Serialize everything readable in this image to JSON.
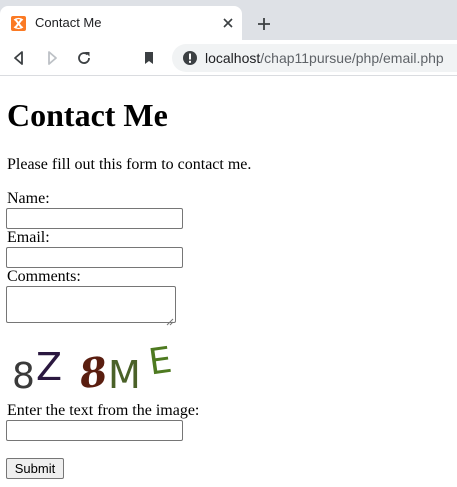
{
  "browser": {
    "tab_title": "Contact Me",
    "url_host": "localhost",
    "url_path": "/chap11pursue/php/email.php"
  },
  "page": {
    "heading": "Contact Me",
    "intro": "Please fill out this form to contact me.",
    "name_label": "Name:",
    "name_value": "",
    "email_label": "Email:",
    "email_value": "",
    "comments_label": "Comments:",
    "comments_value": "",
    "captcha_text": "8Z 8ME",
    "captcha_prompt": "Enter the text from the image:",
    "captcha_value": "",
    "submit_label": "Submit"
  },
  "colors": {
    "favicon": "#fb7a24",
    "tabstrip": "#dee1e6",
    "omnibox": "#f1f3f4"
  }
}
